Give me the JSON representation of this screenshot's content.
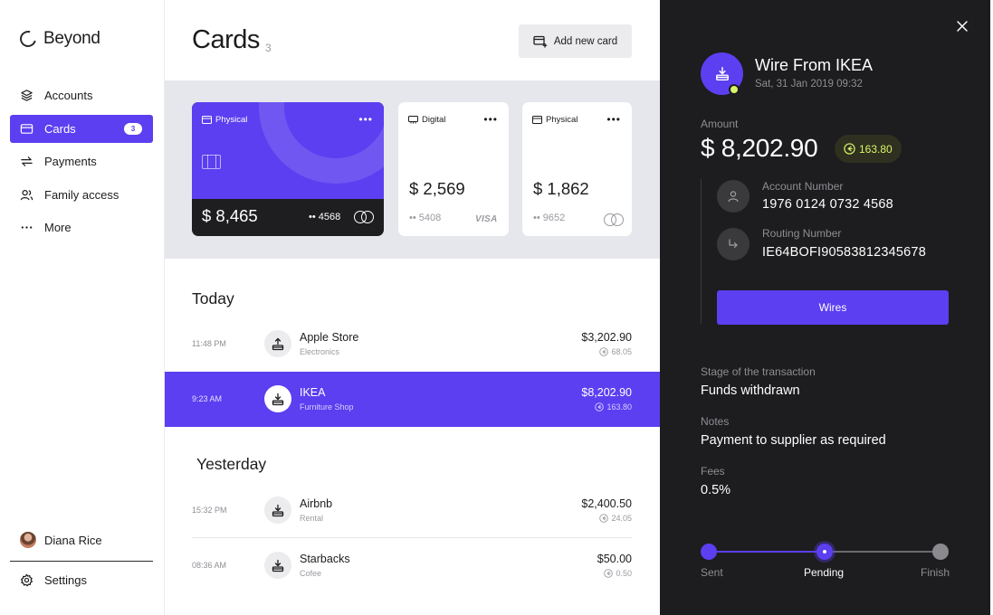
{
  "brand": {
    "name": "Beyond"
  },
  "sidebar": {
    "items": [
      {
        "label": "Accounts",
        "icon": "layers-icon"
      },
      {
        "label": "Cards",
        "icon": "card-icon",
        "badge": "3",
        "active": true
      },
      {
        "label": "Payments",
        "icon": "transfer-arrows-icon"
      },
      {
        "label": "Family access",
        "icon": "users-icon"
      },
      {
        "label": "More",
        "icon": "more-dots-icon"
      }
    ],
    "user": {
      "name": "Diana Rice"
    },
    "settings_label": "Settings"
  },
  "header": {
    "title": "Cards",
    "count": "3",
    "add_card_label": "Add new card"
  },
  "cards": [
    {
      "type": "Physical",
      "balance": "$ 8,465",
      "last4": "•• 4568",
      "network": "mastercard",
      "color": "#5b3ff0"
    },
    {
      "type": "Digital",
      "balance": "$ 2,569",
      "last4": "•• 5408",
      "network": "VISA"
    },
    {
      "type": "Physical",
      "balance": "$ 1,862",
      "last4": "•• 9652",
      "network": "mastercard"
    }
  ],
  "transactions": {
    "today_label": "Today",
    "yesterday_label": "Yesterday",
    "today": [
      {
        "time": "11:48 PM",
        "name": "Apple Store",
        "category": "Electronics",
        "amount": "$3,202.90",
        "points": "68.05",
        "icon": "upload-tray-icon"
      },
      {
        "time": "9:23 AM",
        "name": "IKEA",
        "category": "Furniture Shop",
        "amount": "$8,202.90",
        "points": "163.80",
        "icon": "download-tray-icon",
        "selected": true
      }
    ],
    "yesterday": [
      {
        "time": "15:32 PM",
        "name": "Airbnb",
        "category": "Rental",
        "amount": "$2,400.50",
        "points": "24.05",
        "icon": "download-tray-icon"
      },
      {
        "time": "08:36 AM",
        "name": "Starbacks",
        "category": "Cofee",
        "amount": "$50.00",
        "points": "0.50",
        "icon": "download-tray-icon"
      }
    ]
  },
  "detail": {
    "title": "Wire From IKEA",
    "date": "Sat, 31 Jan 2019 09:32",
    "amount_label": "Amount",
    "amount": "$ 8,202.90",
    "points": "163.80",
    "account_number_label": "Account Number",
    "account_number": "1976 0124 0732 4568",
    "routing_number_label": "Routing Number",
    "routing_number": "IE64BOFI90583812345678",
    "wires_button": "Wires",
    "stage_label": "Stage of the transaction",
    "stage": "Funds withdrawn",
    "notes_label": "Notes",
    "notes": "Payment to supplier as required",
    "fees_label": "Fees",
    "fees": "0.5%",
    "steps": [
      "Sent",
      "Pending",
      "Finish"
    ],
    "current_step": 1
  },
  "colors": {
    "accent": "#5b3ff0",
    "points": "#d6f56a",
    "panel": "#1d1c1e"
  }
}
